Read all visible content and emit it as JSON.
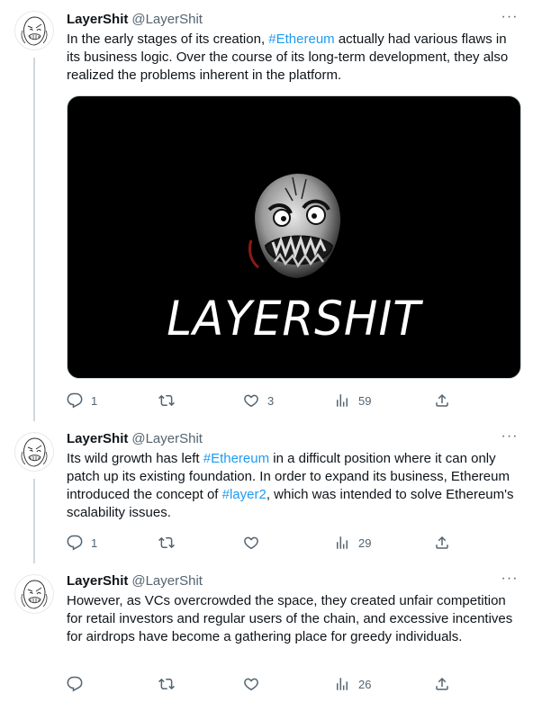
{
  "tweets": [
    {
      "name": "LayerShit",
      "handle": "@LayerShit",
      "more": "···",
      "text_parts": [
        "In the early stages of its creation, ",
        "#Ethereum",
        " actually had various flaws in its business logic. Over the course of its long-term development, they also realized the problems inherent in the platform."
      ],
      "media_text": "LAYERSHIT",
      "replies": "1",
      "retweets": "",
      "likes": "3",
      "views": "59"
    },
    {
      "name": "LayerShit",
      "handle": "@LayerShit",
      "more": "···",
      "text_parts": [
        "Its wild growth has left ",
        "#Ethereum",
        " in a difficult position where it can only patch up its existing foundation. In order to expand its business, Ethereum introduced the concept of ",
        "#layer2",
        ", which was intended to solve Ethereum's scalability issues."
      ],
      "replies": "1",
      "retweets": "",
      "likes": "",
      "views": "29"
    },
    {
      "name": "LayerShit",
      "handle": "@LayerShit",
      "more": "···",
      "text_parts": [
        "However, as VCs overcrowded the space, they created unfair competition for retail investors and regular users of the chain, and excessive incentives for airdrops have become a gathering place for greedy individuals."
      ],
      "replies": "",
      "retweets": "",
      "likes": "",
      "views": "26"
    }
  ],
  "icons": {
    "reply": "reply-icon",
    "retweet": "retweet-icon",
    "like": "heart-icon",
    "views": "views-icon",
    "share": "share-icon"
  },
  "colors": {
    "link": "#1d9bf0",
    "muted": "#536471",
    "line": "#cfd9de"
  }
}
